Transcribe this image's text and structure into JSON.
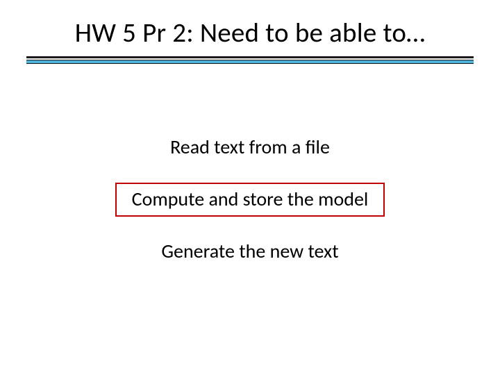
{
  "slide": {
    "title": "HW 5 Pr 2: Need to be able to…",
    "items": [
      {
        "text": "Read text from a file",
        "highlighted": false
      },
      {
        "text": "Compute and store the model",
        "highlighted": true
      },
      {
        "text": "Generate the new text",
        "highlighted": false
      }
    ]
  }
}
